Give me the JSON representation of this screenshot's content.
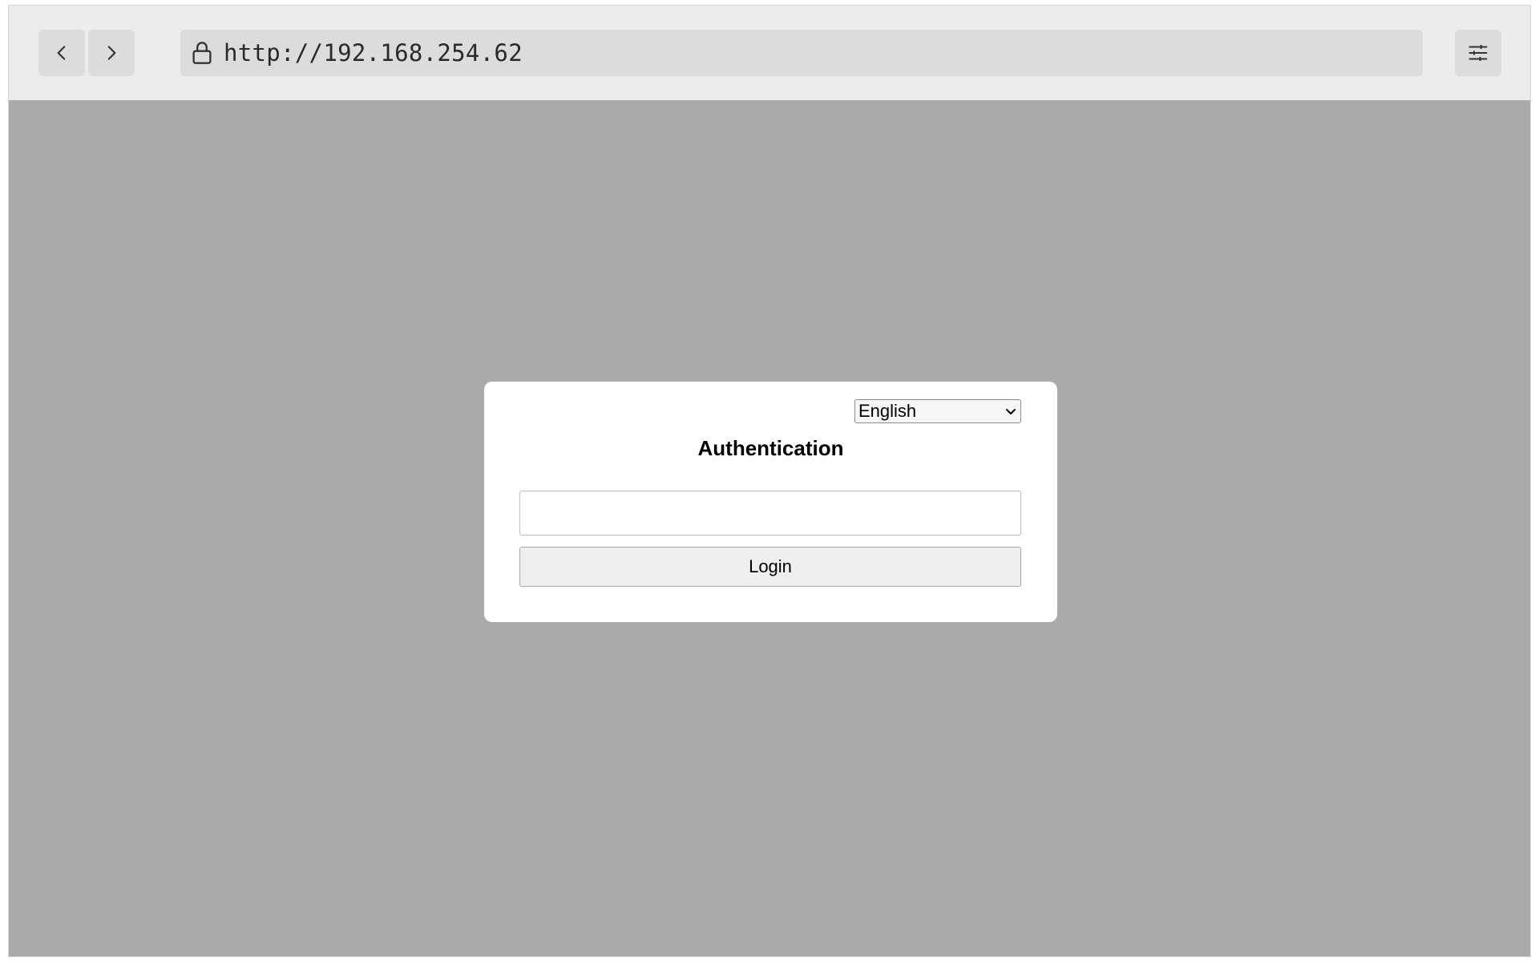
{
  "browser": {
    "url": "http://192.168.254.62",
    "icons": {
      "back": "chevron-left-icon",
      "forward": "chevron-right-icon",
      "lock": "lock-icon",
      "settings": "sliders-icon"
    }
  },
  "login_card": {
    "language_selected": "English",
    "title": "Authentication",
    "input_value": "",
    "login_label": "Login"
  },
  "colors": {
    "page_background": "#aaaaaa",
    "toolbar_background": "#ececec",
    "card_background": "#ffffff"
  }
}
